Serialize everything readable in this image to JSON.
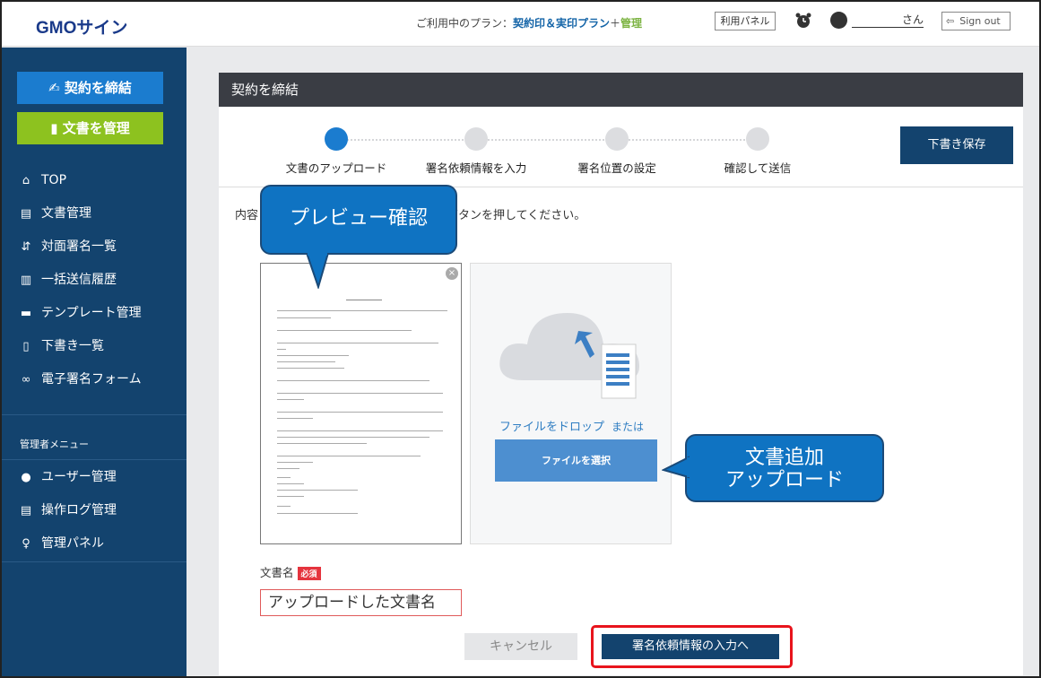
{
  "header": {
    "logo": "GMOサイン",
    "plan_prefix": "ご利用中のプラン：",
    "plan_name": "契約印＆実印プラン",
    "plan_plus": "＋",
    "plan_extra": "管理",
    "panel_label": "利用パネル",
    "user_suffix": "さん",
    "signout_label": "Sign out"
  },
  "sidebar": {
    "contract_button": "契約を締結",
    "manage_button": "文書を管理",
    "items": [
      {
        "label": "TOP",
        "icon": "home-icon"
      },
      {
        "label": "文書管理",
        "icon": "document-icon"
      },
      {
        "label": "対面署名一覧",
        "icon": "face-to-face-icon"
      },
      {
        "label": "一括送信履歴",
        "icon": "bulk-send-icon"
      },
      {
        "label": "テンプレート管理",
        "icon": "template-icon"
      },
      {
        "label": "下書き一覧",
        "icon": "draft-icon"
      },
      {
        "label": "電子署名フォーム",
        "icon": "link-icon"
      }
    ],
    "admin_label": "管理者メニュー",
    "admin_items": [
      {
        "label": "ユーザー管理",
        "icon": "user-icon"
      },
      {
        "label": "操作ログ管理",
        "icon": "log-icon"
      },
      {
        "label": "管理パネル",
        "icon": "admin-icon"
      }
    ]
  },
  "main": {
    "title": "契約を締結",
    "steps": [
      {
        "label": "文書のアップロード",
        "active": true
      },
      {
        "label": "署名依頼情報を入力",
        "active": false
      },
      {
        "label": "署名位置の設定",
        "active": false
      },
      {
        "label": "確認して送信",
        "active": false
      }
    ],
    "draft_button": "下書き保存",
    "instruction_start": "内容",
    "instruction_end": "ボタンを押してください。",
    "drop_text": "ファイルをドロップ",
    "drop_or": "または",
    "file_button": "ファイルを選択",
    "doc_name_label": "文書名",
    "required_badge": "必須",
    "doc_name_value": "アップロードした文書名",
    "cancel_button": "キャンセル",
    "next_button": "署名依頼情報の入力へ"
  },
  "callouts": {
    "preview": "プレビュー確認",
    "add_line1": "文書追加",
    "add_line2": "アップロード"
  },
  "colors": {
    "sidebar": "#13436e",
    "contract_button": "#1b7ccf",
    "manage_button": "#8dc21f",
    "callout": "#0f73c2",
    "highlight_border": "#e8141c"
  }
}
